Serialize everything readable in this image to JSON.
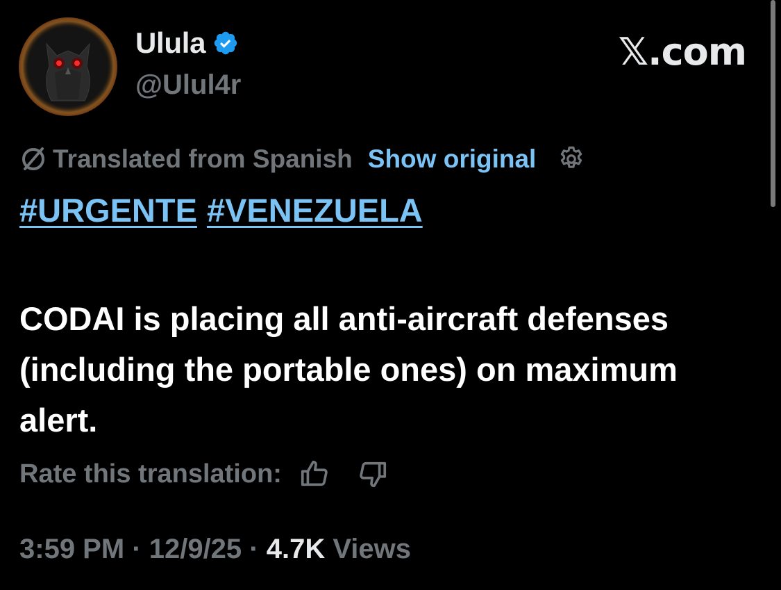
{
  "author": {
    "display_name": "Ulula",
    "handle": "@Ulul4r",
    "verified": true,
    "avatar_icon": "owl-avatar"
  },
  "site_logo": "𝕏.com",
  "translation": {
    "label": "Translated from Spanish",
    "show_original": "Show original",
    "icon": "translate-icon",
    "settings_icon": "gear-icon"
  },
  "hashtags": [
    "#URGENTE",
    "#VENEZUELA"
  ],
  "body": "CODAI is placing all anti-aircraft defenses (including the portable ones) on maximum alert.",
  "rate": {
    "label": "Rate this translation:",
    "up_icon": "thumbs-up-icon",
    "down_icon": "thumbs-down-icon"
  },
  "meta": {
    "time": "3:59 PM",
    "sep1": " · ",
    "date": "12/9/25",
    "sep2": " · ",
    "views_count": "4.7K",
    "views_label": " Views"
  },
  "colors": {
    "background": "#000000",
    "primary_text": "#e7e9ea",
    "secondary_text": "#71767b",
    "link": "#7cc3f5",
    "verified_badge": "#1d9bf0"
  }
}
